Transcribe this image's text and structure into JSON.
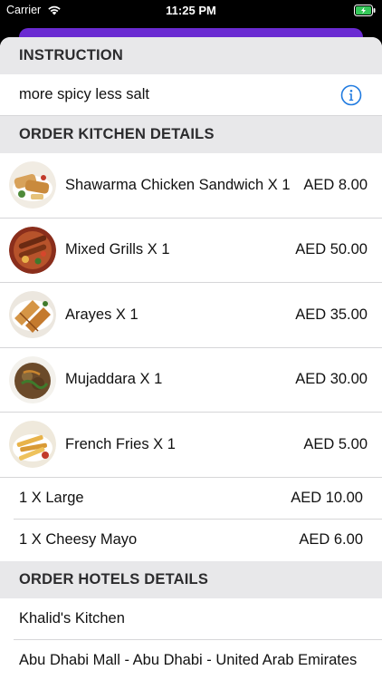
{
  "status_bar": {
    "carrier": "Carrier",
    "time": "11:25 PM"
  },
  "instruction": {
    "header": "INSTRUCTION",
    "text": "more spicy less salt",
    "icon": "info-icon"
  },
  "kitchen": {
    "header": "ORDER KITCHEN DETAILS",
    "items": [
      {
        "name": "Shawarma Chicken Sandwich X 1",
        "price": "AED 8.00"
      },
      {
        "name": "Mixed Grills X 1",
        "price": "AED 50.00"
      },
      {
        "name": "Arayes X 1",
        "price": "AED 35.00"
      },
      {
        "name": "Mujaddara X 1",
        "price": "AED 30.00"
      },
      {
        "name": "French Fries X 1",
        "price": "AED 5.00"
      }
    ],
    "extras": [
      {
        "name": "1 X Large",
        "price": "AED 10.00"
      },
      {
        "name": "1 X Cheesy Mayo",
        "price": "AED 6.00"
      }
    ]
  },
  "hotels": {
    "header": "ORDER HOTELS DETAILS",
    "name": "Khalid's Kitchen",
    "address": "Abu Dhabi Mall - Abu Dhabi - United Arab Emirates"
  },
  "colors": {
    "accent": "#6a2bd2",
    "info_blue": "#1f7ae0",
    "header_bg": "#e8e8ea",
    "battery_green": "#34c759"
  }
}
